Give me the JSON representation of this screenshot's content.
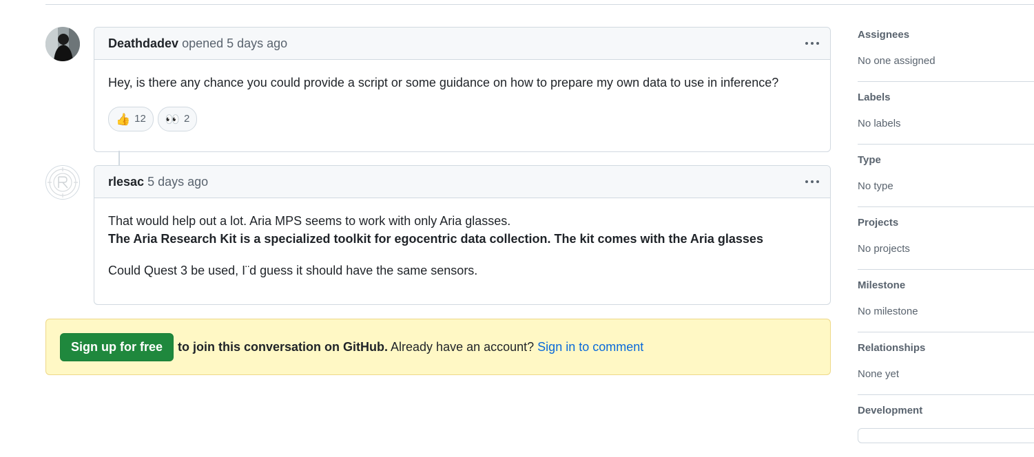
{
  "comments": [
    {
      "author": "Deathdadev",
      "action": "opened 5 days ago",
      "body": "Hey, is there any chance you could provide a script or some guidance on how to prepare my own data to use in inference?",
      "reactions": [
        {
          "emoji": "👍",
          "icon": "thumbs-up-icon",
          "count": "12"
        },
        {
          "emoji": "👀",
          "icon": "eyes-icon",
          "count": "2"
        }
      ]
    },
    {
      "author": "rlesac",
      "action": "5 days ago",
      "body_line1": "That would help out a lot. Aria MPS seems to work with only Aria glasses.",
      "body_line2": "The Aria Research Kit is a specialized toolkit for egocentric data collection. The kit comes with the Aria glasses",
      "body_line3": "Could Quest 3 be used, I¨d guess it should have the same sensors."
    }
  ],
  "signup": {
    "button": "Sign up for free",
    "text_bold": "to join this conversation on GitHub.",
    "text": " Already have an account? ",
    "link": "Sign in to comment"
  },
  "sidebar": [
    {
      "heading": "Assignees",
      "value": "No one assigned"
    },
    {
      "heading": "Labels",
      "value": "No labels"
    },
    {
      "heading": "Type",
      "value": "No type"
    },
    {
      "heading": "Projects",
      "value": "No projects"
    },
    {
      "heading": "Milestone",
      "value": "No milestone"
    },
    {
      "heading": "Relationships",
      "value": "None yet"
    },
    {
      "heading": "Development",
      "value": ""
    }
  ],
  "colors": {
    "accent_green": "#1f883d",
    "link_blue": "#0969da",
    "banner_yellow": "#fff8c5"
  }
}
